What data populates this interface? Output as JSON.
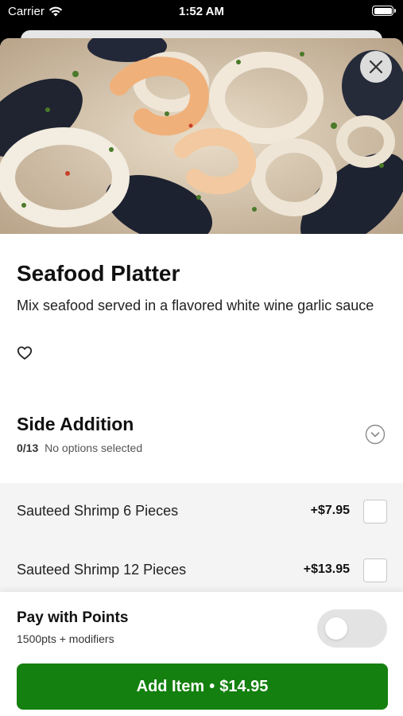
{
  "status_bar": {
    "carrier": "Carrier",
    "time": "1:52 AM"
  },
  "item": {
    "title": "Seafood Platter",
    "description": "Mix seafood served in a flavored white wine garlic sauce",
    "image_icon": "seafood-photo",
    "favorite_icon": "heart-outline-icon"
  },
  "section": {
    "title": "Side Addition",
    "count": "0/13",
    "status": "No options selected"
  },
  "options": [
    {
      "name": "Sauteed Shrimp 6 Pieces",
      "price": "+$7.95",
      "checked": false
    },
    {
      "name": "Sauteed Shrimp 12 Pieces",
      "price": "+$13.95",
      "checked": false
    }
  ],
  "points": {
    "title": "Pay with Points",
    "subtitle": "1500pts + modifiers",
    "enabled": false
  },
  "cta": {
    "label": "Add Item",
    "separator": "•",
    "price": "$14.95"
  },
  "colors": {
    "primary": "#14800f",
    "option_bg": "#f4f4f4",
    "toggle_off": "#e3e3e3"
  }
}
